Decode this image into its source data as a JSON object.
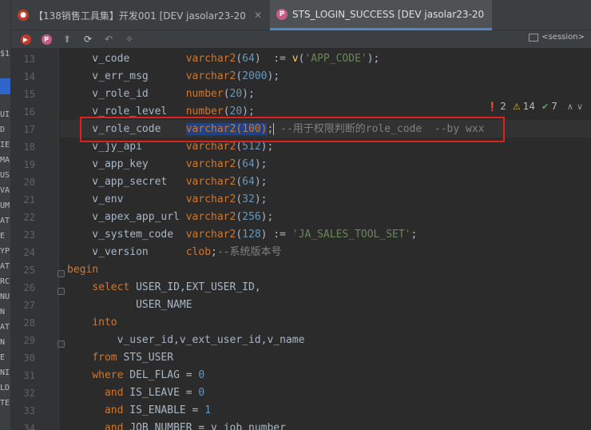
{
  "tabs": [
    {
      "label": "【138销售工具集】开发001 [DEV  jasolar23-20",
      "icon": "oracle-icon",
      "active": false
    },
    {
      "label": "STS_LOGIN_SUCCESS [DEV  jasolar23-20",
      "icon": "package-icon",
      "active": true
    }
  ],
  "toolbar": {
    "session_label": "<session>"
  },
  "left_panel": {
    "clipped_text": [
      "$1",
      "",
      "",
      "",
      "UI",
      "D",
      "IE",
      "MA",
      "US",
      "VA",
      "UM",
      "ATI",
      "E",
      "YP",
      "AT",
      "RCI",
      "NU",
      "N",
      "AT",
      "N",
      "E",
      "NI",
      "LD",
      "TE"
    ]
  },
  "inspections": {
    "errors": "2",
    "warnings": "14",
    "typos": "7"
  },
  "code_lines": [
    {
      "num": "13",
      "segments": [
        [
          "var",
          "    v_code         "
        ],
        [
          "ty",
          "varchar2"
        ],
        [
          "var",
          "("
        ],
        [
          "nm",
          "64"
        ],
        [
          "var",
          ")  := "
        ],
        [
          "fn",
          "v"
        ],
        [
          "var",
          "("
        ],
        [
          "str",
          "'APP_CODE'"
        ],
        [
          "var",
          ");"
        ]
      ]
    },
    {
      "num": "14",
      "segments": [
        [
          "var",
          "    v_err_msg      "
        ],
        [
          "ty",
          "varchar2"
        ],
        [
          "var",
          "("
        ],
        [
          "nm",
          "2000"
        ],
        [
          "var",
          ");"
        ]
      ]
    },
    {
      "num": "15",
      "segments": [
        [
          "var",
          "    v_role_id      "
        ],
        [
          "ty",
          "number"
        ],
        [
          "var",
          "("
        ],
        [
          "nm",
          "20"
        ],
        [
          "var",
          ");"
        ]
      ]
    },
    {
      "num": "16",
      "segments": [
        [
          "var",
          "    v_role_level   "
        ],
        [
          "ty",
          "number"
        ],
        [
          "var",
          "("
        ],
        [
          "nm",
          "20"
        ],
        [
          "var",
          ");"
        ]
      ]
    },
    {
      "num": "17",
      "segments": [
        [
          "var",
          "    v_role_code    "
        ],
        [
          "sel",
          "varchar2(100)"
        ],
        [
          "caret",
          ";"
        ],
        [
          "cmt",
          " --用于权限判断的role_code  --by wxx"
        ]
      ]
    },
    {
      "num": "18",
      "segments": [
        [
          "var",
          "    v_jy_api       "
        ],
        [
          "ty",
          "varchar2"
        ],
        [
          "var",
          "("
        ],
        [
          "nm",
          "512"
        ],
        [
          "var",
          ");"
        ]
      ]
    },
    {
      "num": "19",
      "segments": [
        [
          "var",
          "    v_app_key      "
        ],
        [
          "ty",
          "varchar2"
        ],
        [
          "var",
          "("
        ],
        [
          "nm",
          "64"
        ],
        [
          "var",
          ");"
        ]
      ]
    },
    {
      "num": "20",
      "segments": [
        [
          "var",
          "    v_app_secret   "
        ],
        [
          "ty",
          "varchar2"
        ],
        [
          "var",
          "("
        ],
        [
          "nm",
          "64"
        ],
        [
          "var",
          ");"
        ]
      ]
    },
    {
      "num": "21",
      "segments": [
        [
          "var",
          "    v_env          "
        ],
        [
          "ty",
          "varchar2"
        ],
        [
          "var",
          "("
        ],
        [
          "nm",
          "32"
        ],
        [
          "var",
          ");"
        ]
      ]
    },
    {
      "num": "22",
      "segments": [
        [
          "var",
          "    v_apex_app_url "
        ],
        [
          "ty",
          "varchar2"
        ],
        [
          "var",
          "("
        ],
        [
          "nm",
          "256"
        ],
        [
          "var",
          ");"
        ]
      ]
    },
    {
      "num": "23",
      "segments": [
        [
          "var",
          "    v_system_code  "
        ],
        [
          "ty",
          "varchar2"
        ],
        [
          "var",
          "("
        ],
        [
          "nm",
          "128"
        ],
        [
          "var",
          ") := "
        ],
        [
          "str",
          "'JA_SALES_TOOL_SET'"
        ],
        [
          "var",
          ";"
        ]
      ]
    },
    {
      "num": "24",
      "segments": [
        [
          "var",
          "    v_version      "
        ],
        [
          "ty",
          "clob"
        ],
        [
          "var",
          ";"
        ],
        [
          "cmt",
          "--系统版本号"
        ]
      ]
    },
    {
      "num": "25",
      "segments": [
        [
          "kw",
          "begin"
        ]
      ]
    },
    {
      "num": "26",
      "segments": [
        [
          "var",
          "    "
        ],
        [
          "kw",
          "select "
        ],
        [
          "var",
          "USER_ID,EXT_USER_ID,"
        ]
      ]
    },
    {
      "num": "27",
      "segments": [
        [
          "var",
          "           USER_NAME"
        ]
      ]
    },
    {
      "num": "28",
      "segments": [
        [
          "var",
          "    "
        ],
        [
          "kw",
          "into"
        ]
      ]
    },
    {
      "num": "29",
      "segments": [
        [
          "var",
          "        v_user_id,v_ext_user_id,v_name"
        ]
      ]
    },
    {
      "num": "30",
      "segments": [
        [
          "var",
          "    "
        ],
        [
          "kw",
          "from "
        ],
        [
          "var",
          "STS_USER"
        ]
      ]
    },
    {
      "num": "31",
      "segments": [
        [
          "var",
          "    "
        ],
        [
          "kw",
          "where "
        ],
        [
          "var",
          "DEL_FLAG = "
        ],
        [
          "nm",
          "0"
        ]
      ]
    },
    {
      "num": "32",
      "segments": [
        [
          "var",
          "      "
        ],
        [
          "kw",
          "and "
        ],
        [
          "var",
          "IS_LEAVE = "
        ],
        [
          "nm",
          "0"
        ]
      ]
    },
    {
      "num": "33",
      "segments": [
        [
          "var",
          "      "
        ],
        [
          "kw",
          "and "
        ],
        [
          "var",
          "IS_ENABLE = "
        ],
        [
          "nm",
          "1"
        ]
      ]
    },
    {
      "num": "34",
      "segments": [
        [
          "var",
          "      "
        ],
        [
          "kw",
          "and "
        ],
        [
          "var",
          "JOB_NUMBER = v_job_number"
        ]
      ]
    }
  ]
}
